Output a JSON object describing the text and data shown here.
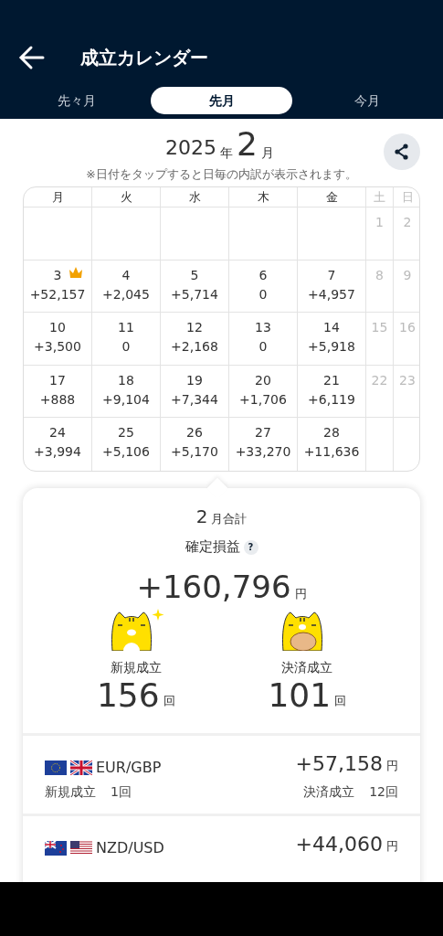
{
  "header": {
    "title": "成立カレンダー"
  },
  "tabs": [
    {
      "label": "先々月",
      "selected": false
    },
    {
      "label": "先月",
      "selected": true
    },
    {
      "label": "今月",
      "selected": false
    }
  ],
  "calendar": {
    "year": "2025",
    "year_unit": "年",
    "month": "2",
    "month_unit": "月",
    "note": "※日付をタップすると日毎の内訳が表示されます。",
    "weekdays": [
      {
        "label": "月",
        "weekend": false
      },
      {
        "label": "火",
        "weekend": false
      },
      {
        "label": "水",
        "weekend": false
      },
      {
        "label": "木",
        "weekend": false
      },
      {
        "label": "金",
        "weekend": false
      },
      {
        "label": "土",
        "weekend": true
      },
      {
        "label": "日",
        "weekend": true
      }
    ],
    "weeks": [
      [
        {
          "day": "1",
          "weekend": true
        },
        {
          "day": "2",
          "weekend": true
        }
      ],
      [
        {
          "day": "3",
          "value": "+52,157",
          "top": true,
          "weekend": false
        },
        {
          "day": "4",
          "value": "+2,045",
          "top": false,
          "weekend": false
        },
        {
          "day": "5",
          "value": "+5,714",
          "top": false,
          "weekend": false
        },
        {
          "day": "6",
          "value": "0",
          "top": false,
          "weekend": false
        },
        {
          "day": "7",
          "value": "+4,957",
          "top": false,
          "weekend": false
        },
        {
          "day": "8",
          "weekend": true
        },
        {
          "day": "9",
          "weekend": true
        }
      ],
      [
        {
          "day": "10",
          "value": "+3,500",
          "top": false,
          "weekend": false
        },
        {
          "day": "11",
          "value": "0",
          "top": false,
          "weekend": false
        },
        {
          "day": "12",
          "value": "+2,168",
          "top": false,
          "weekend": false
        },
        {
          "day": "13",
          "value": "0",
          "top": false,
          "weekend": false
        },
        {
          "day": "14",
          "value": "+5,918",
          "top": false,
          "weekend": false
        },
        {
          "day": "15",
          "weekend": true
        },
        {
          "day": "16",
          "weekend": true
        }
      ],
      [
        {
          "day": "17",
          "value": "+888",
          "top": false,
          "weekend": false
        },
        {
          "day": "18",
          "value": "+9,104",
          "top": false,
          "weekend": false
        },
        {
          "day": "19",
          "value": "+7,344",
          "top": false,
          "weekend": false
        },
        {
          "day": "20",
          "value": "+1,706",
          "top": false,
          "weekend": false
        },
        {
          "day": "21",
          "value": "+6,119",
          "top": false,
          "weekend": false
        },
        {
          "day": "22",
          "weekend": true
        },
        {
          "day": "23",
          "weekend": true
        }
      ],
      [
        {
          "day": "24",
          "value": "+3,994",
          "top": false,
          "weekend": false
        },
        {
          "day": "25",
          "value": "+5,106",
          "top": false,
          "weekend": false
        },
        {
          "day": "26",
          "value": "+5,170",
          "top": false,
          "weekend": false
        },
        {
          "day": "27",
          "value": "+33,270",
          "top": false,
          "weekend": false
        },
        {
          "day": "28",
          "value": "+11,636",
          "top": false,
          "weekend": false
        }
      ]
    ]
  },
  "summary": {
    "month": "2",
    "title_suffix": "月合計",
    "pl_label": "確定損益",
    "help": "?",
    "pl_value": "+160,796",
    "pl_unit": "円",
    "stats": [
      {
        "kind": "open",
        "label": "新規成立",
        "value": "156",
        "unit": "回"
      },
      {
        "kind": "close",
        "label": "決済成立",
        "value": "101",
        "unit": "回"
      }
    ]
  },
  "pairs": [
    {
      "pair": "EUR/GBP",
      "value": "+57,158",
      "unit": "円",
      "open_label": "新規成立",
      "open_count": "1回",
      "close_label": "決済成立",
      "close_count": "12回"
    },
    {
      "pair": "NZD/USD",
      "value": "+44,060",
      "unit": "円"
    }
  ]
}
